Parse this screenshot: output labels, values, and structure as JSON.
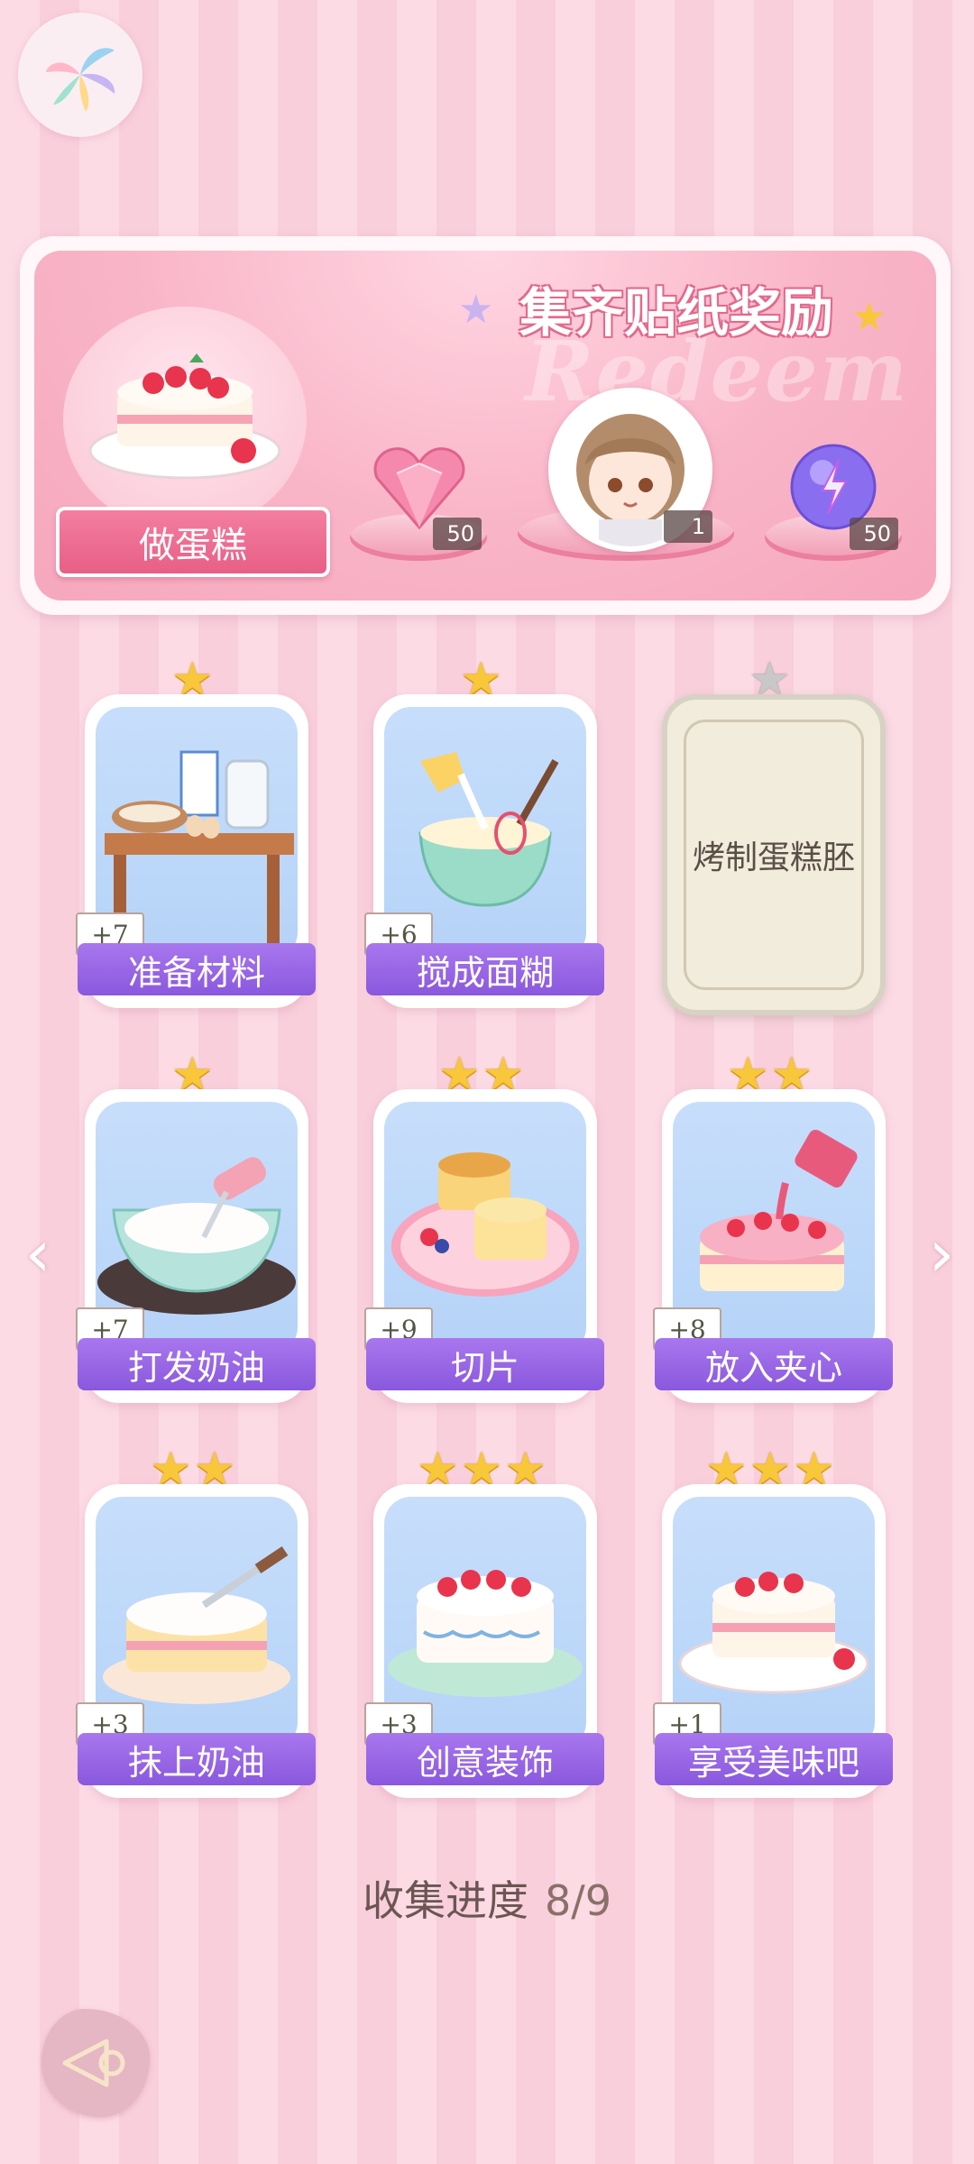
{
  "banner": {
    "title": "集齐贴纸奖励",
    "watermark": "Redeem",
    "make_cake_label": "做蛋糕",
    "rewards": [
      {
        "icon": "pink-heart-gem-icon",
        "count": "50"
      },
      {
        "icon": "avatar-frame-icon",
        "count": "1"
      },
      {
        "icon": "purple-energy-orb-icon",
        "count": "50"
      }
    ]
  },
  "cards": [
    {
      "label": "准备材料",
      "count": "+7",
      "stars": 1
    },
    {
      "label": "搅成面糊",
      "count": "+6",
      "stars": 1
    },
    {
      "label": "烤制蛋糕胚",
      "locked": true,
      "stars": 1
    },
    {
      "label": "打发奶油",
      "count": "+7",
      "stars": 1
    },
    {
      "label": "切片",
      "count": "+9",
      "stars": 2
    },
    {
      "label": "放入夹心",
      "count": "+8",
      "stars": 2
    },
    {
      "label": "抹上奶油",
      "count": "+3",
      "stars": 2
    },
    {
      "label": "创意装饰",
      "count": "+3",
      "stars": 3
    },
    {
      "label": "享受美味吧",
      "count": "+1",
      "stars": 3
    }
  ],
  "progress": {
    "label": "收集进度",
    "value": "8/9"
  },
  "colors": {
    "accent_pink": "#e85f86",
    "label_purple": "#8a58dd",
    "star_gold": "#f8c73a"
  }
}
